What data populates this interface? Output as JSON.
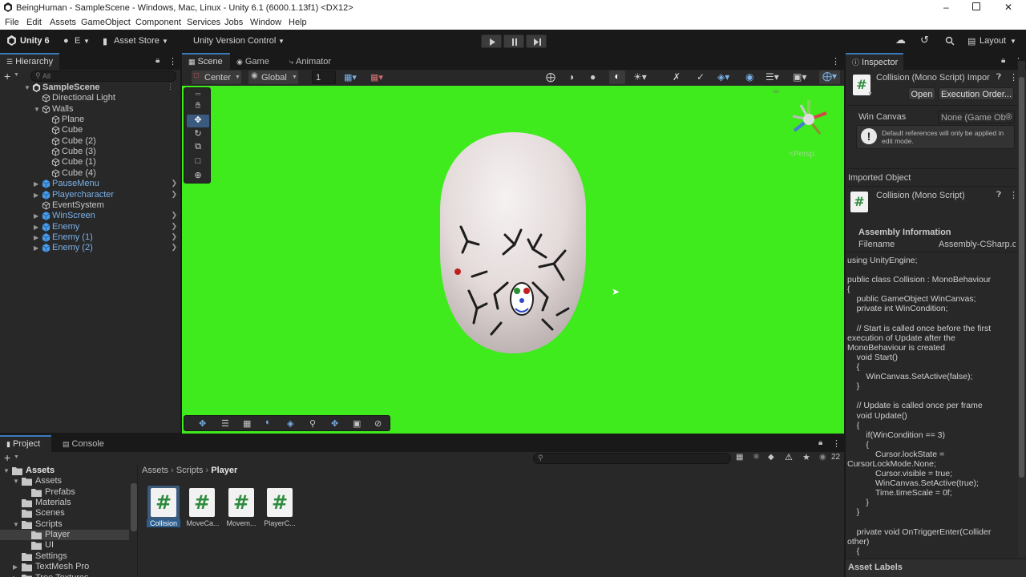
{
  "window": {
    "title": "BeingHuman - SampleScene - Windows, Mac, Linux - Unity 6.1 (6000.1.13f1) <DX12>"
  },
  "menu": [
    "File",
    "Edit",
    "Assets",
    "GameObject",
    "Component",
    "Services",
    "Jobs",
    "Window",
    "Help"
  ],
  "toolbar": {
    "account": "Unity 6",
    "user_initial": "E",
    "asset_store": "Asset Store",
    "version_control": "Unity Version Control",
    "layout": "Layout"
  },
  "hierarchy": {
    "tab": "Hierarchy",
    "search_placeholder": "All",
    "items": [
      {
        "label": "SampleScene",
        "depth": 0,
        "kind": "scene"
      },
      {
        "label": "Directional Light",
        "depth": 1
      },
      {
        "label": "Walls",
        "depth": 1
      },
      {
        "label": "Plane",
        "depth": 2
      },
      {
        "label": "Cube",
        "depth": 2
      },
      {
        "label": "Cube (2)",
        "depth": 2
      },
      {
        "label": "Cube (3)",
        "depth": 2
      },
      {
        "label": "Cube (1)",
        "depth": 2
      },
      {
        "label": "Cube (4)",
        "depth": 2
      },
      {
        "label": "PauseMenu",
        "depth": 1,
        "prefab": true
      },
      {
        "label": "Playercharacter",
        "depth": 1,
        "prefab": true
      },
      {
        "label": "EventSystem",
        "depth": 1
      },
      {
        "label": "WinScreen",
        "depth": 1,
        "prefab": true
      },
      {
        "label": "Enemy",
        "depth": 1,
        "prefab": true
      },
      {
        "label": "Enemy (1)",
        "depth": 1,
        "prefab": true
      },
      {
        "label": "Enemy (2)",
        "depth": 1,
        "prefab": true
      }
    ]
  },
  "scene": {
    "tabs": [
      "Scene",
      "Game",
      "Animator"
    ],
    "pivot": "Center",
    "space": "Global",
    "grid_size": "1",
    "persp_label": "<Persp"
  },
  "project": {
    "tabs": [
      "Project",
      "Console"
    ],
    "breadcrumb": [
      "Assets",
      "Scripts",
      "Player"
    ],
    "tree": [
      {
        "label": "Assets",
        "depth": 0,
        "bold": true
      },
      {
        "label": "Assets",
        "depth": 1
      },
      {
        "label": "Prefabs",
        "depth": 2
      },
      {
        "label": "Materials",
        "depth": 1
      },
      {
        "label": "Scenes",
        "depth": 1
      },
      {
        "label": "Scripts",
        "depth": 1
      },
      {
        "label": "Player",
        "depth": 2,
        "selected": true
      },
      {
        "label": "UI",
        "depth": 2
      },
      {
        "label": "Settings",
        "depth": 1
      },
      {
        "label": "TextMesh Pro",
        "depth": 1
      },
      {
        "label": "Tree Textures",
        "depth": 1
      }
    ],
    "files": [
      "Collision",
      "MoveCa...",
      "Movem...",
      "PlayerC..."
    ],
    "count": "22"
  },
  "inspector": {
    "tab": "Inspector",
    "header": "Collision (Mono Script) Impor",
    "open_btn": "Open",
    "exec_btn": "Execution Order...",
    "field_label": "Win Canvas",
    "field_value": "None (Game Ob",
    "info": "Default references will only be applied in edit mode.",
    "imported_object": "Imported Object",
    "script_name": "Collision (Mono Script)",
    "assembly_title": "Assembly Information",
    "filename_label": "Filename",
    "filename_value": "Assembly-CSharp.c",
    "code": "using UnityEngine;\n\npublic class Collision : MonoBehaviour\n{\n    public GameObject WinCanvas;\n    private int WinCondition;\n\n    // Start is called once before the first execution of Update after the MonoBehaviour is created\n    void Start()\n    {\n        WinCanvas.SetActive(false);\n    }\n\n    // Update is called once per frame\n    void Update()\n    {\n        if(WinCondition == 3)\n        {\n            Cursor.lockState = CursorLockMode.None;\n            Cursor.visible = true;\n            WinCanvas.SetActive(true);\n            Time.timeScale = 0f;\n        }\n    }\n\n    private void OnTriggerEnter(Collider other)\n    {",
    "asset_labels": "Asset Labels"
  },
  "colors": {
    "scene_bg": "#3fea1d",
    "accent": "#3a79bb",
    "prefab": "#7ab1e8"
  }
}
